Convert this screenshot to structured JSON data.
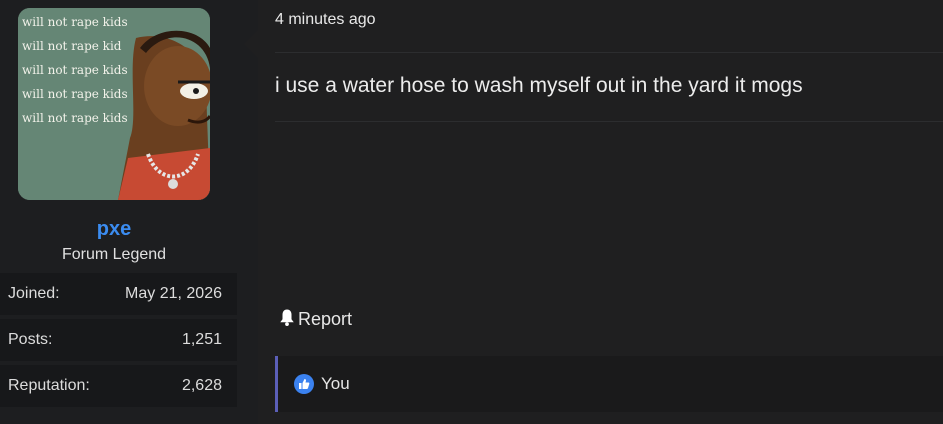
{
  "user": {
    "avatar_text": [
      "will not rape kids",
      "will not rape kid",
      "will not rape kids",
      "will not rape kids",
      "will not rape kids"
    ],
    "username": "pxe",
    "title": "Forum Legend",
    "stats": [
      {
        "label": "Joined:",
        "value": "May 21, 2026"
      },
      {
        "label": "Posts:",
        "value": "1,251"
      },
      {
        "label": "Reputation:",
        "value": "2,628"
      }
    ]
  },
  "post": {
    "timestamp": "4 minutes ago",
    "content": "i use a water hose to wash myself out in the yard it mogs",
    "report_label": "Report",
    "report_icon": "bell-icon",
    "reactions": {
      "icon": "thumbs-up-icon",
      "text": "You",
      "color": "#3b82f0"
    }
  },
  "colors": {
    "username": "#3b8cf0",
    "reaction_border": "#5b5fb8"
  }
}
